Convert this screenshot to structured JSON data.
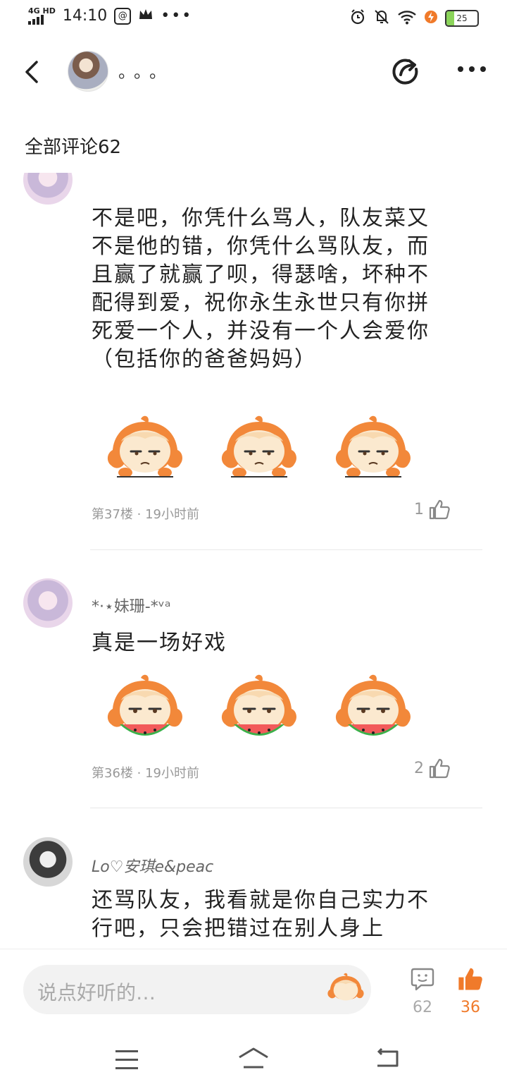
{
  "status_bar": {
    "network": "4G HD",
    "time": "14:10",
    "battery": "25",
    "battery_level": 0.25
  },
  "header": {
    "name": "。。。",
    "back_icon": "chevron-left-icon",
    "share_icon": "share-icon",
    "more_icon": "more-icon"
  },
  "comments_title": "全部评论62",
  "comments": [
    {
      "name": "",
      "text": "不是吧，你凭什么骂人，队友菜又不是他的错，你凭什么骂队友，而且赢了就赢了呗，得瑟啥，坏种不配得到爱，祝你永生永世只有你拼死爱一个人，并没有一个人会爱你（包括你的爸爸妈妈）",
      "floor": "第37楼",
      "time": "19小时前",
      "likes": "1"
    },
    {
      "name": "*·⋆妹珊-*ᵛᵃ",
      "text": "真是一场好戏",
      "floor": "第36楼",
      "time": "19小时前",
      "likes": "2"
    },
    {
      "name": "Lo♡安琪e&peac",
      "text": "还骂队友，我看就是你自己实力不行吧，只会把错过在别人身上"
    }
  ],
  "bottom_bar": {
    "placeholder": "说点好听的…",
    "comment_count": "62",
    "like_count": "36"
  },
  "colors": {
    "accent": "#f07a2a",
    "sticker_orange": "#f2883a"
  }
}
